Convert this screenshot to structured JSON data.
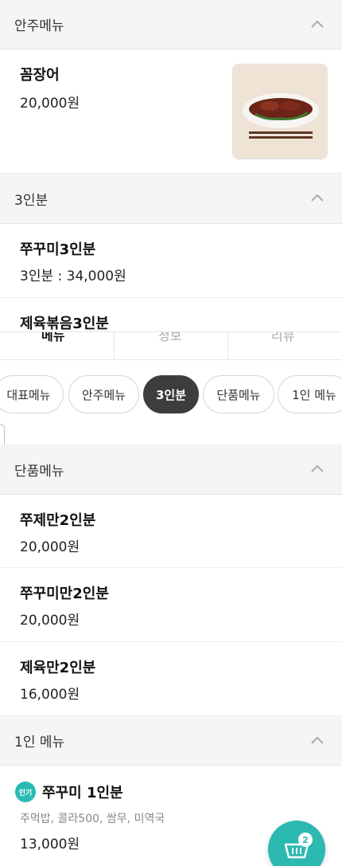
{
  "sections": {
    "appetizer": {
      "title": "안주메뉴"
    },
    "three_person": {
      "title": "3인분"
    },
    "single": {
      "title": "단품메뉴"
    },
    "one_person": {
      "title": "1인 메뉴"
    }
  },
  "items": {
    "eel": {
      "name": "꼼장어",
      "price": "20,000원"
    },
    "jukkumi3": {
      "name": "쭈꾸미3인분",
      "price": "3인분 : 34,000원"
    },
    "jeyuk3": {
      "name": "제육볶음3인분"
    },
    "jujeman2": {
      "name": "쭈제만2인분",
      "price": "20,000원"
    },
    "jukkumiman2": {
      "name": "쭈꾸미만2인분",
      "price": "20,000원"
    },
    "jeyukman2": {
      "name": "제육만2인분",
      "price": "16,000원"
    },
    "jukkumi1": {
      "name": "쭈꾸미 1인분",
      "desc": "주먹밥, 콜라500, 쌈무, 미역국",
      "price": "13,000원",
      "badge": "인기"
    }
  },
  "tabs": [
    "메뉴",
    "정보",
    "리뷰"
  ],
  "chips": [
    "대표메뉴",
    "안주메뉴",
    "3인분",
    "단품메뉴",
    "1인 메뉴"
  ],
  "cart": {
    "count": "2"
  },
  "colors": {
    "accent": "#2bb9b2",
    "chip_active": "#3d3d3d"
  }
}
